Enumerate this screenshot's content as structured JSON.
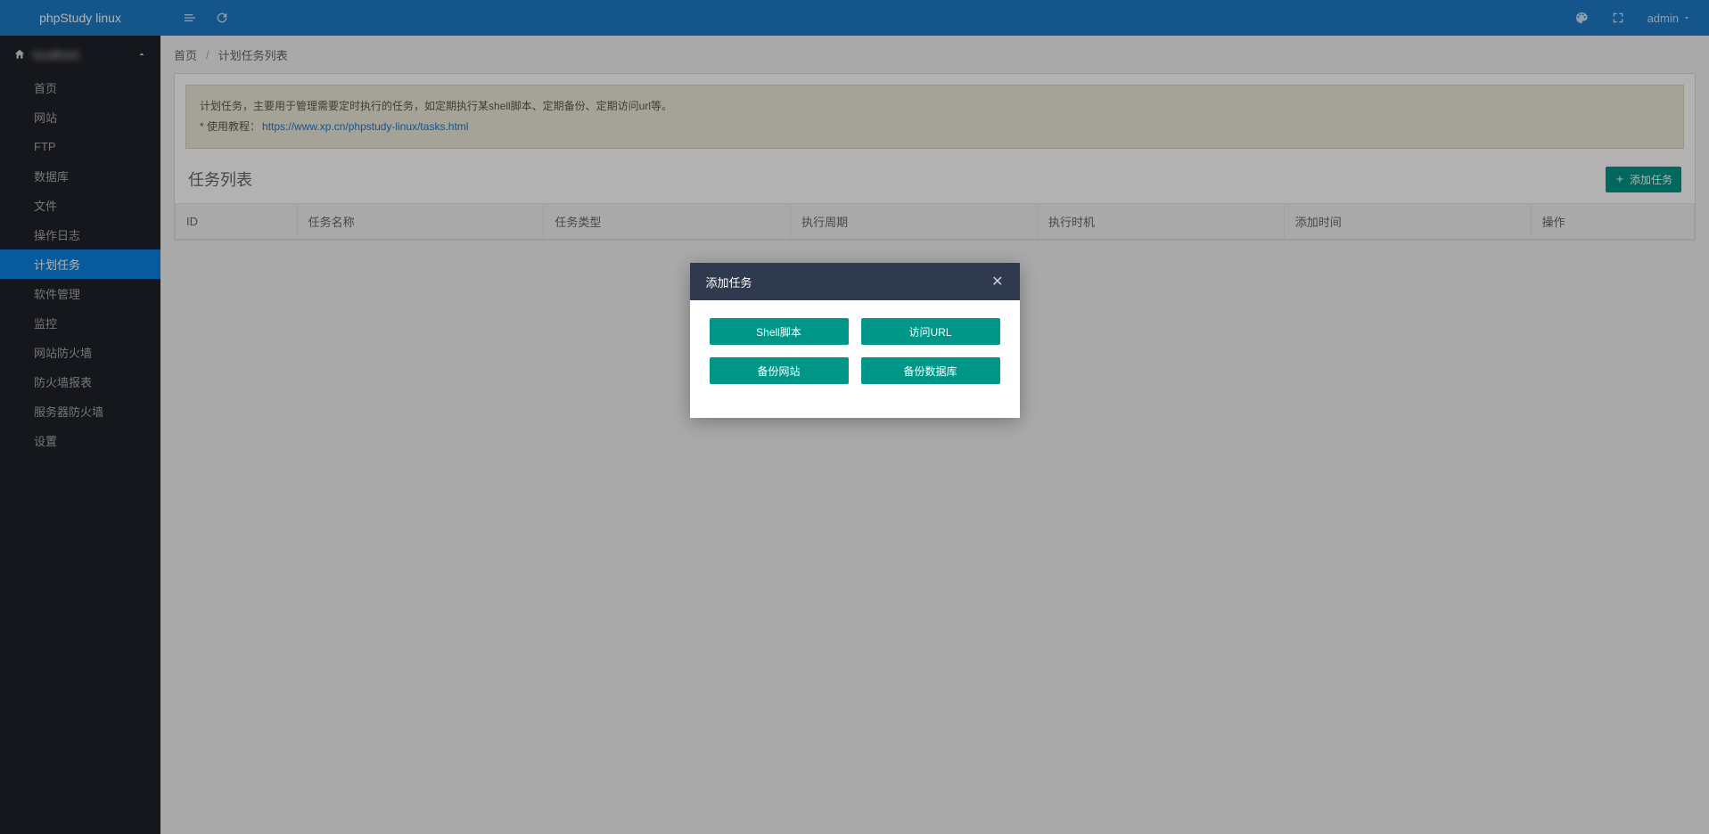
{
  "header": {
    "logo": "phpStudy linux",
    "user": "admin"
  },
  "sidebar": {
    "host_label": "localhost",
    "items": [
      {
        "label": "首页",
        "active": false
      },
      {
        "label": "网站",
        "active": false
      },
      {
        "label": "FTP",
        "active": false
      },
      {
        "label": "数据库",
        "active": false
      },
      {
        "label": "文件",
        "active": false
      },
      {
        "label": "操作日志",
        "active": false
      },
      {
        "label": "计划任务",
        "active": true
      },
      {
        "label": "软件管理",
        "active": false
      },
      {
        "label": "监控",
        "active": false
      },
      {
        "label": "网站防火墙",
        "active": false
      },
      {
        "label": "防火墙报表",
        "active": false
      },
      {
        "label": "服务器防火墙",
        "active": false
      },
      {
        "label": "设置",
        "active": false
      }
    ]
  },
  "breadcrumb": {
    "home": "首页",
    "current": "计划任务列表"
  },
  "info": {
    "line1": "计划任务，主要用于管理需要定时执行的任务，如定期执行某shell脚本、定期备份、定期访问url等。",
    "tutorial_prefix": "* 使用教程：",
    "tutorial_link": "https://www.xp.cn/phpstudy-linux/tasks.html"
  },
  "panel": {
    "title": "任务列表",
    "add_btn": "添加任务"
  },
  "table": {
    "columns": [
      "ID",
      "任务名称",
      "任务类型",
      "执行周期",
      "执行时机",
      "添加时间",
      "操作"
    ],
    "rows": []
  },
  "modal": {
    "title": "添加任务",
    "buttons": [
      "Shell脚本",
      "访问URL",
      "备份网站",
      "备份数据库"
    ]
  }
}
